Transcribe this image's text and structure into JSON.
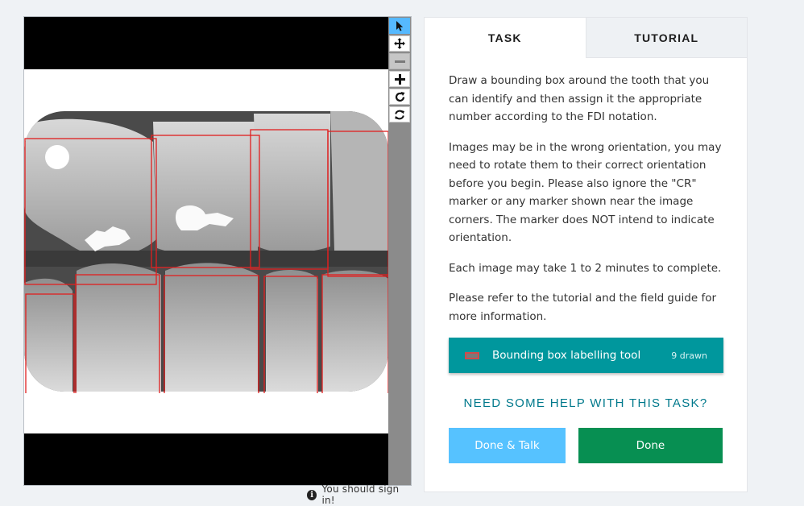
{
  "viewer": {
    "tools": [
      {
        "name": "select-pointer-icon",
        "state": "active"
      },
      {
        "name": "move-icon",
        "state": "normal"
      },
      {
        "name": "zoom-out-icon",
        "state": "disabled"
      },
      {
        "name": "zoom-in-icon",
        "state": "normal"
      },
      {
        "name": "rotate-icon",
        "state": "normal"
      },
      {
        "name": "reset-icon",
        "state": "normal"
      }
    ],
    "annotation_color": "#e01f1f"
  },
  "signin": {
    "text": "You should sign in!"
  },
  "tabs": {
    "task": "TASK",
    "tutorial": "TUTORIAL"
  },
  "task": {
    "paragraphs": [
      "Draw a bounding box around the tooth that you can identify and then assign it the appropriate number according to the FDI notation.",
      "Images may be in the wrong orientation, you may need to rotate them to their correct orientation before you begin. Please also ignore the \"CR\" marker or any marker shown near the image corners. The marker does NOT intend to indicate orientation.",
      "Each image may take 1 to 2 minutes to complete.",
      "Please refer to the tutorial and the field guide for more information."
    ],
    "tool": {
      "label": "Bounding box labelling tool",
      "count": "9 drawn"
    },
    "help": "NEED SOME HELP WITH THIS TASK?",
    "buttons": {
      "talk": "Done & Talk",
      "done": "Done"
    }
  },
  "colors": {
    "accent_teal": "#00979d",
    "done_green": "#078f52",
    "talk_blue": "#56c2ff",
    "link_teal": "#00798c"
  }
}
